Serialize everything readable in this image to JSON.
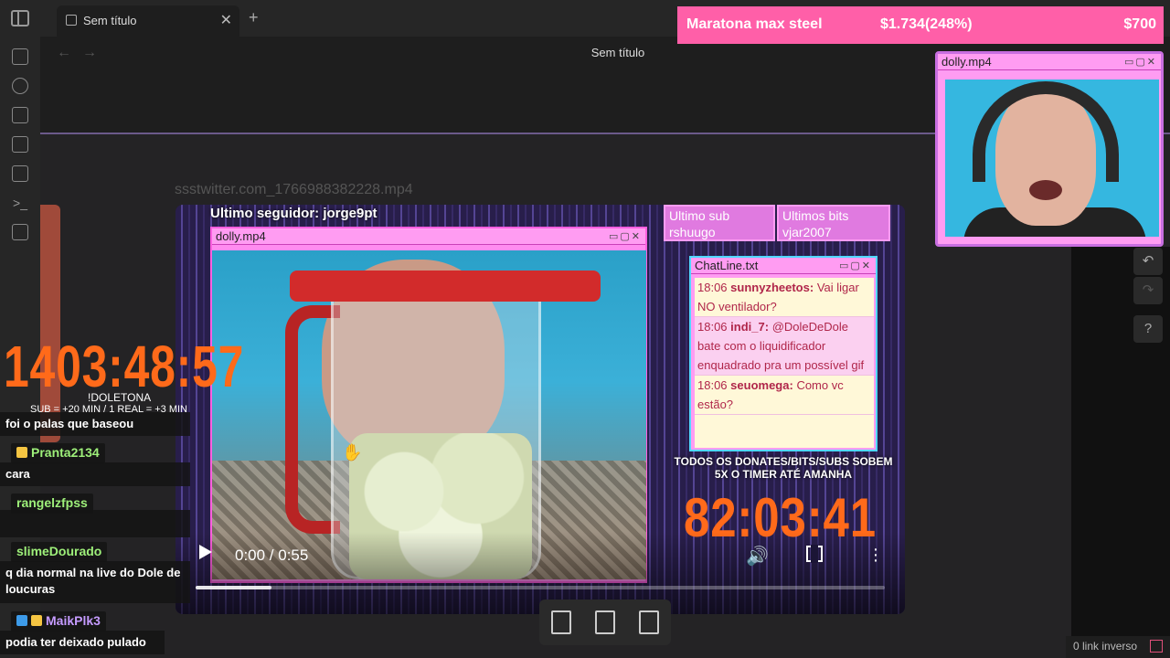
{
  "tab": {
    "title": "Sem título"
  },
  "header": {
    "title": "Sem título"
  },
  "file": {
    "name": "ssstwitter.com_1766988382228.mp4"
  },
  "video": {
    "seguidor": "Ultimo seguidor: jorge9pt",
    "cam_window_title": "dolly.mp4",
    "ultimo_sub_label": "Ultimo sub",
    "ultimo_sub_value": "rshuugo",
    "ultimo_bits_label": "Ultimos bits",
    "ultimo_bits_value": "vjar2007",
    "chat_window_title": "ChatLine.txt",
    "chat": [
      {
        "time": "18:06",
        "user": "sunnyzheetos:",
        "text": "Vai ligar NO ventilador?"
      },
      {
        "time": "18:06",
        "user": "indi_7:",
        "text": "@DoleDeDole bate com o liquidificador enquadrado pra um possível gif"
      },
      {
        "time": "18:06",
        "user": "seuomega:",
        "text": "Como vc estão?"
      }
    ],
    "donates_text": "TODOS OS DONATES/BITS/SUBS SOBEM 5X O TIMER ATÉ AMANHA",
    "timer": "82:03:41",
    "time_display": "0:00 / 0:55",
    "progress": 0.11
  },
  "overlay": {
    "donation": {
      "label": "Maratona max steel",
      "amount": "$1.734(248%)",
      "goal": "$700"
    },
    "cam_title": "dolly.mp4",
    "timer": "1403:48:57",
    "timer_title": "!DOLETONA",
    "timer_rule": "SUB = +20 MIN / 1 REAL = +3 MIN",
    "chat": [
      {
        "user": "",
        "text": "foi o palas que baseou"
      },
      {
        "user": "Pranta2134",
        "text": "cara"
      },
      {
        "user": "rangelzfpss",
        "text": ""
      },
      {
        "user": "slimeDourado",
        "text": "q dia normal na live do Dole de loucuras"
      },
      {
        "user": "MaikPlk3",
        "text": "podia ter deixado pulado"
      }
    ]
  },
  "status": {
    "backlinks": "0 link inverso"
  },
  "colors": {
    "accent": "#ff6a1a",
    "pink": "#ff9cf2"
  }
}
